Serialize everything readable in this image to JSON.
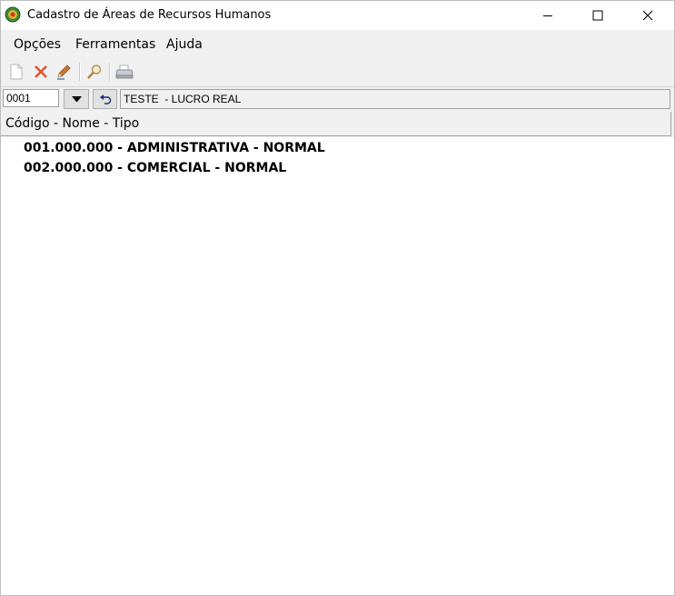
{
  "window": {
    "title": "Cadastro de Áreas de Recursos Humanos",
    "buttons": [
      "minimize-icon",
      "maximize-icon",
      "close-icon"
    ]
  },
  "menu": {
    "items": [
      "Opções",
      "Ferramentas",
      "Ajuda"
    ]
  },
  "toolbar": {
    "icons": [
      "new-document-icon",
      "delete-icon",
      "edit-pencil-icon",
      "search-icon",
      "print-icon"
    ]
  },
  "selector": {
    "code": "0001",
    "company": "TESTE  - LUCRO REAL"
  },
  "list": {
    "header": "Código - Nome - Tipo",
    "rows": [
      "001.000.000 - ADMINISTRATIVA - NORMAL",
      "002.000.000 - COMERCIAL - NORMAL"
    ]
  }
}
